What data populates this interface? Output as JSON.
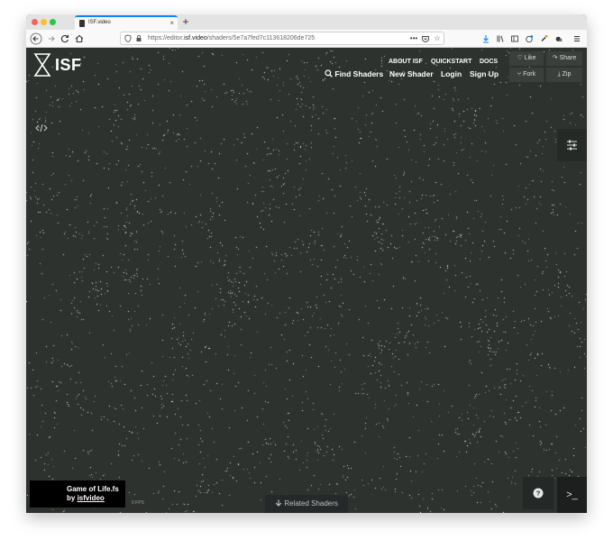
{
  "browser": {
    "tab_title": "ISF.video",
    "new_tab_symbol": "+",
    "url_prefix": "https://editor.",
    "url_domain": "isf.video",
    "url_path": "/shaders/5e7a7fed7c113618206de725",
    "icons": [
      "back-icon",
      "forward-icon",
      "reload-icon",
      "home-icon",
      "shield-icon",
      "lock-icon",
      "more-icon",
      "pocket-icon",
      "star-icon",
      "download-icon",
      "library-icon",
      "sidebar-icon",
      "extension-icon",
      "menu-icon"
    ]
  },
  "header": {
    "logo_text": "ISF",
    "top_links": [
      "ABOUT ISF",
      "QUICKSTART",
      "DOCS"
    ],
    "find_shaders": "Find Shaders",
    "new_shader": "New Shader",
    "login": "Login",
    "sign_up": "Sign Up"
  },
  "actions": {
    "like": "Like",
    "share": "Share",
    "fork": "Fork",
    "zip": "Zip"
  },
  "shader": {
    "title": "Game of Life.fs",
    "by": "by",
    "author": "isfvideo",
    "fps": "0 FPS"
  },
  "footer": {
    "related_shaders": "Related Shaders",
    "console_symbol": ">_"
  },
  "colors": {
    "background": "#2e322f",
    "accent": "#0a84ff"
  }
}
